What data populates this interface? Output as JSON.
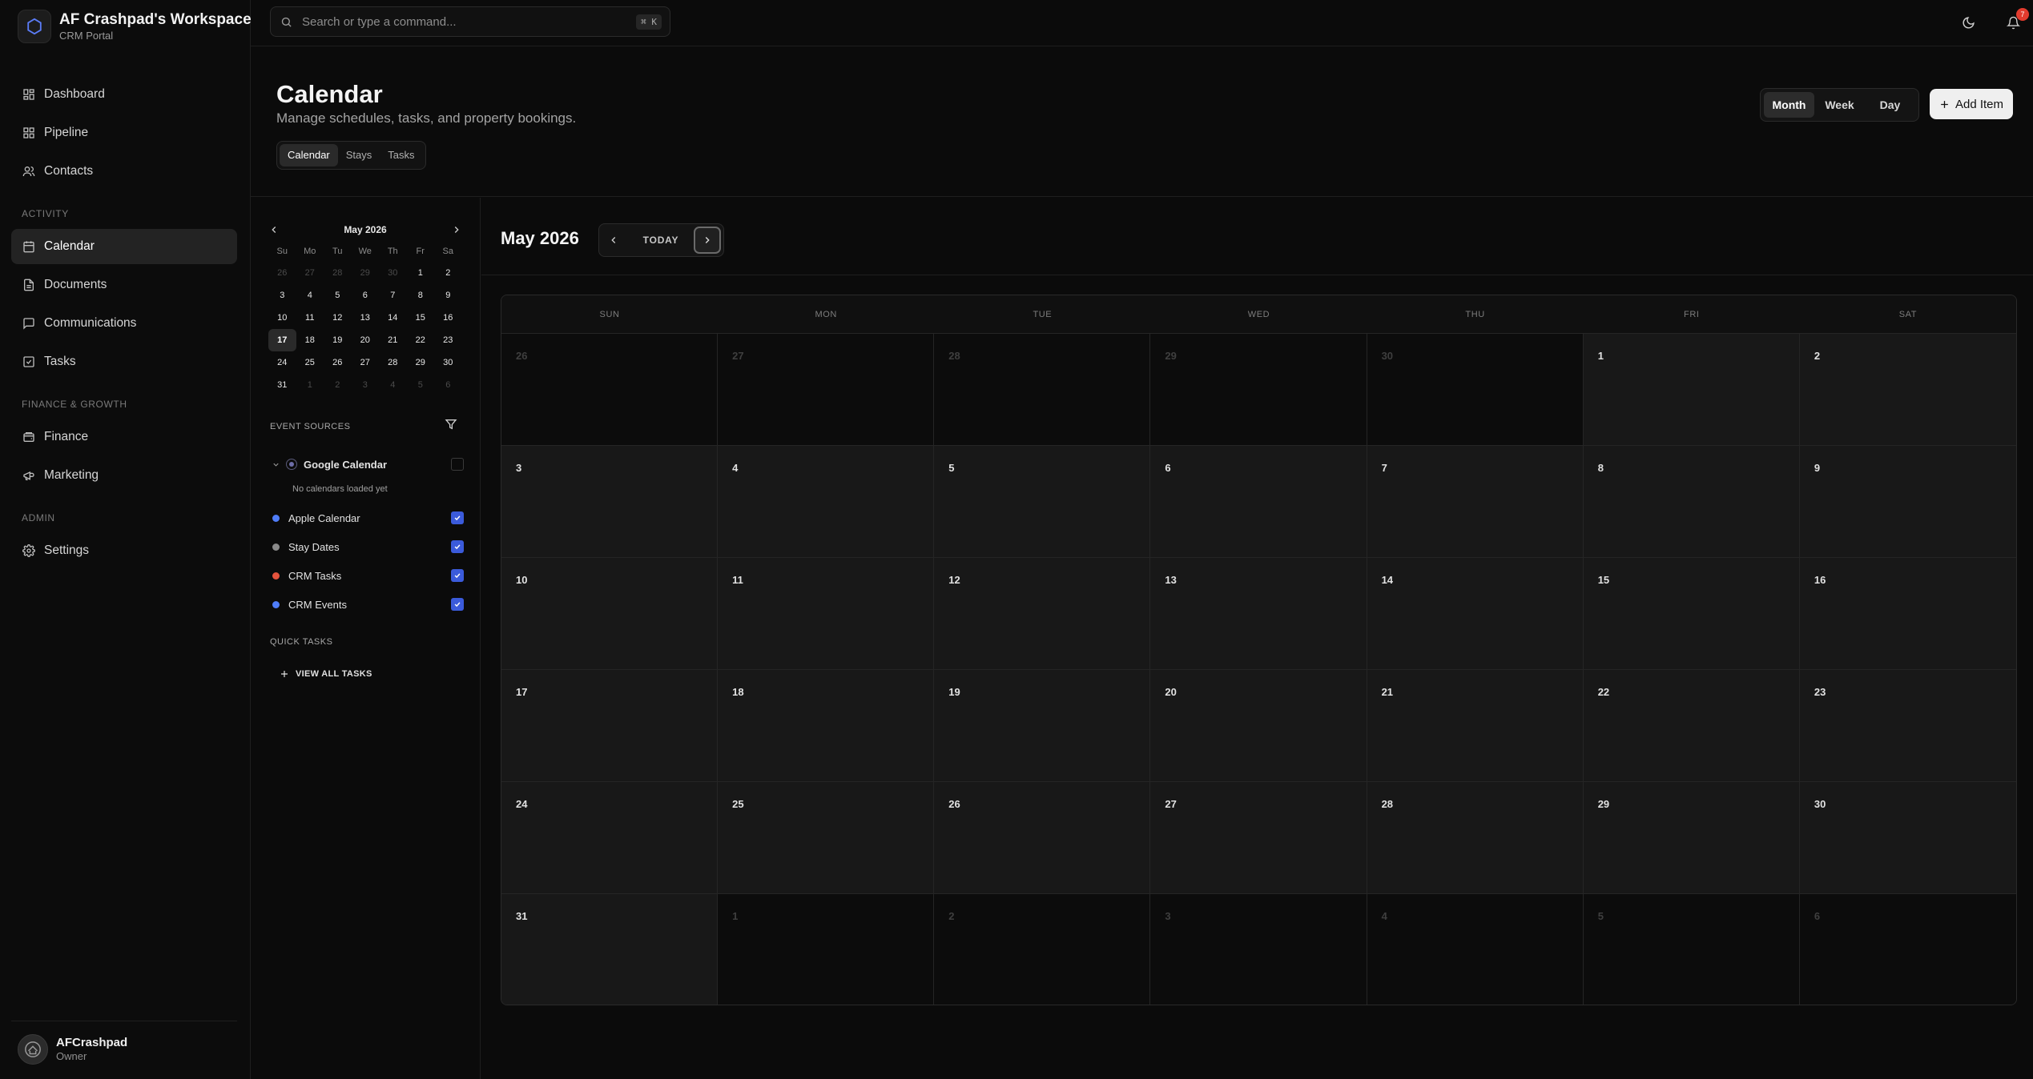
{
  "workspace": {
    "title": "AF Crashpad's Workspace",
    "subtitle": "CRM Portal"
  },
  "nav": {
    "dashboard": "Dashboard",
    "pipeline": "Pipeline",
    "contacts": "Contacts",
    "section_activity": "ACTIVITY",
    "calendar": "Calendar",
    "documents": "Documents",
    "communications": "Communications",
    "tasks": "Tasks",
    "section_finance": "FINANCE & GROWTH",
    "finance": "Finance",
    "marketing": "Marketing",
    "section_admin": "ADMIN",
    "settings": "Settings"
  },
  "user": {
    "name": "AFCrashpad",
    "role": "Owner"
  },
  "topbar": {
    "search_placeholder": "Search or type a command...",
    "shortcut": "⌘ K",
    "notification_count": "7"
  },
  "header": {
    "title": "Calendar",
    "subtitle": "Manage schedules, tasks, and property bookings.",
    "tabs": [
      "Calendar",
      "Stays",
      "Tasks"
    ],
    "views": [
      "Month",
      "Week",
      "Day"
    ],
    "add_label": "Add Item"
  },
  "mini_calendar": {
    "title": "May 2026",
    "weekdays": [
      "Su",
      "Mo",
      "Tu",
      "We",
      "Th",
      "Fr",
      "Sa"
    ],
    "days": [
      [
        "26",
        "27",
        "28",
        "29",
        "30",
        "1",
        "2"
      ],
      [
        "3",
        "4",
        "5",
        "6",
        "7",
        "8",
        "9"
      ],
      [
        "10",
        "11",
        "12",
        "13",
        "14",
        "15",
        "16"
      ],
      [
        "17",
        "18",
        "19",
        "20",
        "21",
        "22",
        "23"
      ],
      [
        "24",
        "25",
        "26",
        "27",
        "28",
        "29",
        "30"
      ],
      [
        "31",
        "1",
        "2",
        "3",
        "4",
        "5",
        "6"
      ]
    ]
  },
  "event_sources": {
    "heading": "EVENT SOURCES",
    "google": {
      "label": "Google Calendar",
      "empty": "No calendars loaded yet",
      "checked": false
    },
    "items": [
      {
        "label": "Apple Calendar",
        "color": "#4f7df9",
        "checked": true
      },
      {
        "label": "Stay Dates",
        "color": "#8a8a8a",
        "checked": true
      },
      {
        "label": "CRM Tasks",
        "color": "#e5533d",
        "checked": true
      },
      {
        "label": "CRM Events",
        "color": "#4f7df9",
        "checked": true
      }
    ]
  },
  "quick_tasks": {
    "heading": "QUICK TASKS",
    "view_all": "VIEW ALL TASKS"
  },
  "calendar": {
    "month_title": "May 2026",
    "today_label": "TODAY",
    "weekdays": [
      "SUN",
      "MON",
      "TUE",
      "WED",
      "THU",
      "FRI",
      "SAT"
    ],
    "days": [
      [
        "26",
        "27",
        "28",
        "29",
        "30",
        "1",
        "2"
      ],
      [
        "3",
        "4",
        "5",
        "6",
        "7",
        "8",
        "9"
      ],
      [
        "10",
        "11",
        "12",
        "13",
        "14",
        "15",
        "16"
      ],
      [
        "17",
        "18",
        "19",
        "20",
        "21",
        "22",
        "23"
      ],
      [
        "24",
        "25",
        "26",
        "27",
        "28",
        "29",
        "30"
      ],
      [
        "31",
        "1",
        "2",
        "3",
        "4",
        "5",
        "6"
      ]
    ]
  }
}
